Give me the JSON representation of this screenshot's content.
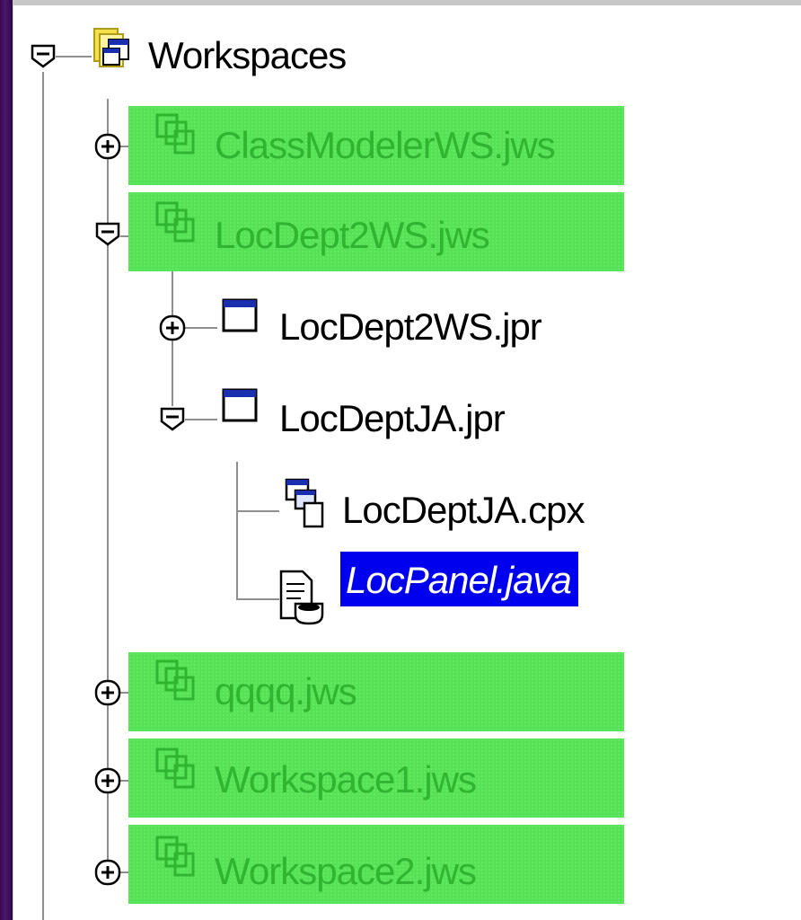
{
  "tree": {
    "root": {
      "label": "Workspaces",
      "expanded": true,
      "icon": "workspaces-folder-icon"
    },
    "items": [
      {
        "label": "ClassModelerWS.jws",
        "expanded": false,
        "icon": "workspace-icon",
        "highlight": "#55e355"
      },
      {
        "label": "LocDept2WS.jws",
        "expanded": true,
        "icon": "workspace-icon",
        "highlight": "#55e355",
        "children": [
          {
            "label": "LocDept2WS.jpr",
            "expanded": false,
            "icon": "project-icon"
          },
          {
            "label": "LocDeptJA.jpr",
            "expanded": true,
            "icon": "project-icon",
            "children": [
              {
                "label": "LocDeptJA.cpx",
                "icon": "connections-file-icon"
              },
              {
                "label": "LocPanel.java",
                "icon": "java-file-icon",
                "selected": true,
                "selection_color": "#0000ee"
              }
            ]
          }
        ]
      },
      {
        "label": "qqqq.jws",
        "expanded": false,
        "icon": "workspace-icon",
        "highlight": "#55e355"
      },
      {
        "label": "Workspace1.jws",
        "expanded": false,
        "icon": "workspace-icon",
        "highlight": "#55e355"
      },
      {
        "label": "Workspace2.jws",
        "expanded": false,
        "icon": "workspace-icon",
        "highlight": "#55e355"
      }
    ]
  }
}
